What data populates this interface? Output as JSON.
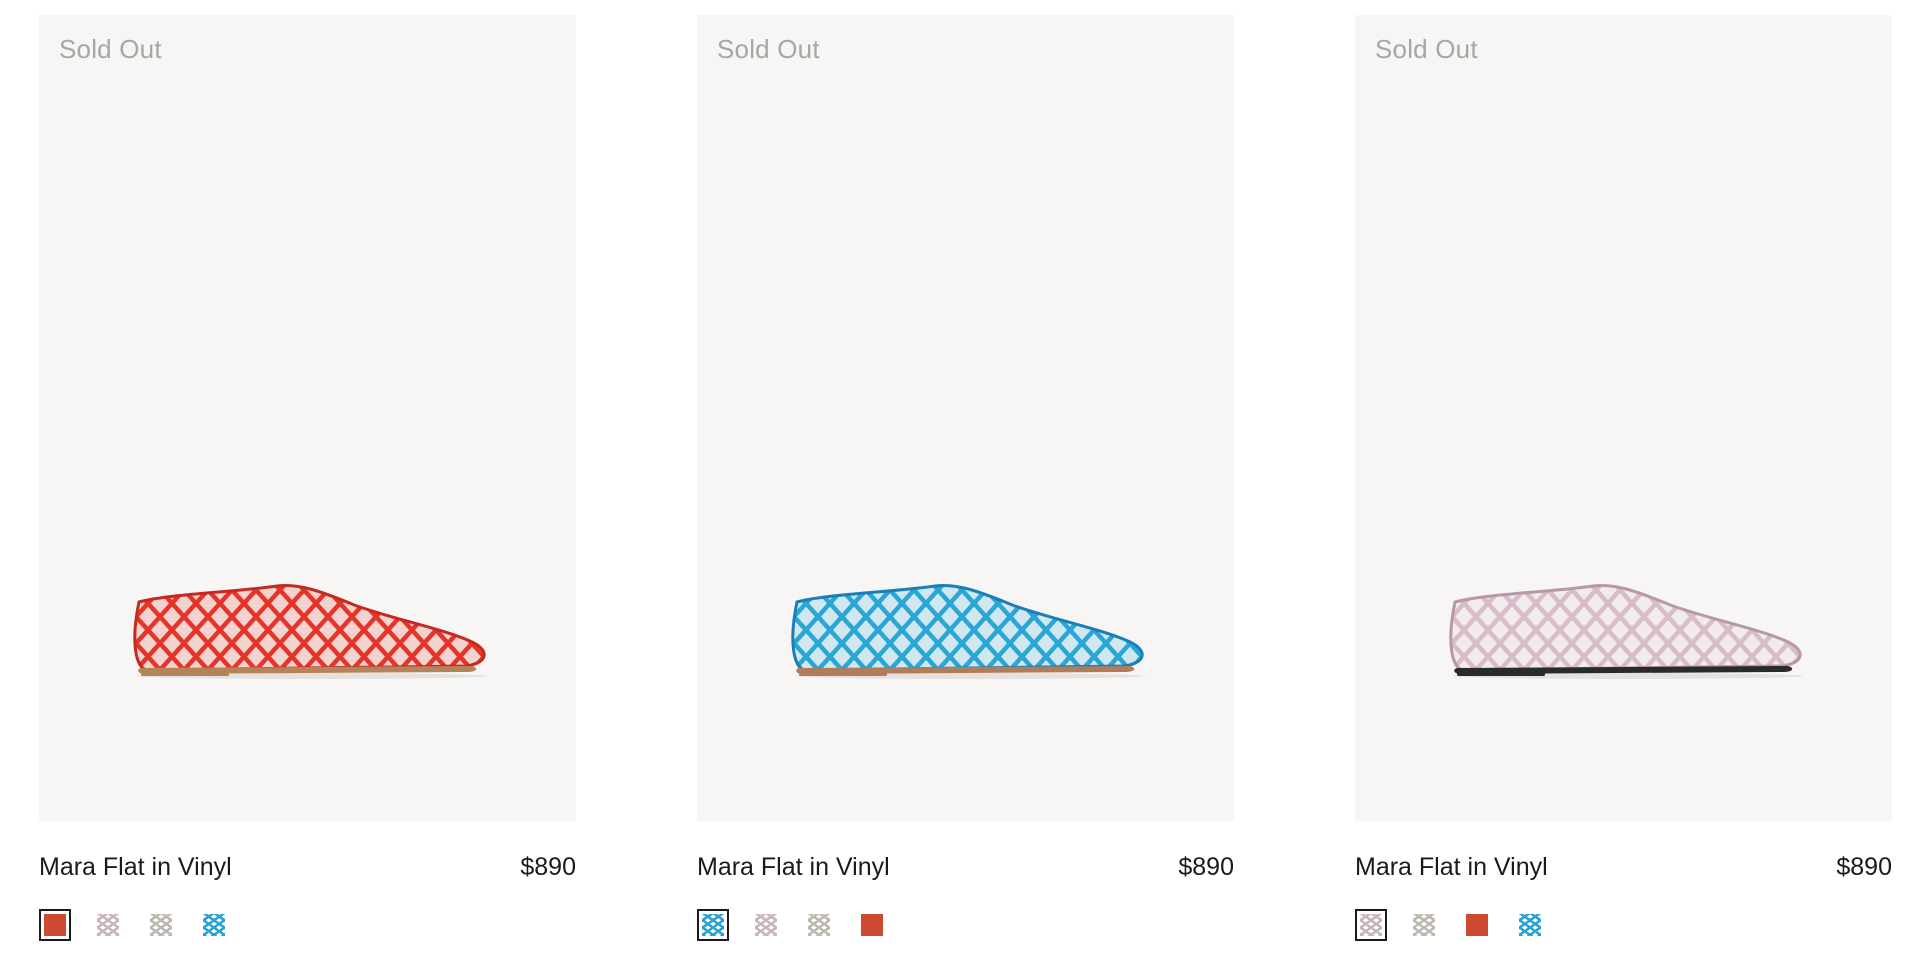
{
  "products": [
    {
      "badge": "Sold Out",
      "name": "Mara Flat in Vinyl",
      "price": "$890",
      "shoe_color": "#e5352a",
      "shoe_shade": "#c42a20",
      "sole_color": "#b58358",
      "swatches": [
        {
          "color": "#cc4a30",
          "label": "red",
          "selected": true
        },
        {
          "color": "#c8b4bf",
          "label": "pink",
          "selected": false
        },
        {
          "color": "#bcb8b0",
          "label": "clear",
          "selected": false
        },
        {
          "color": "#27a3cf",
          "label": "blue",
          "selected": false
        }
      ]
    },
    {
      "badge": "Sold Out",
      "name": "Mara Flat in Vinyl",
      "price": "$890",
      "shoe_color": "#29a5d6",
      "shoe_shade": "#1a7fb8",
      "sole_color": "#b07c5a",
      "swatches": [
        {
          "color": "#27a3cf",
          "label": "blue",
          "selected": true
        },
        {
          "color": "#c8b4bf",
          "label": "pink",
          "selected": false
        },
        {
          "color": "#bcb8b0",
          "label": "clear",
          "selected": false
        },
        {
          "color": "#cc4a30",
          "label": "red",
          "selected": false
        }
      ]
    },
    {
      "badge": "Sold Out",
      "name": "Mara Flat in Vinyl",
      "price": "$890",
      "shoe_color": "#d7bcc9",
      "shoe_shade": "#b898a8",
      "sole_color": "#2a2a2a",
      "swatches": [
        {
          "color": "#c8b4bf",
          "label": "pink",
          "selected": true
        },
        {
          "color": "#bcb8b0",
          "label": "clear",
          "selected": false
        },
        {
          "color": "#cc4a30",
          "label": "red",
          "selected": false
        },
        {
          "color": "#27a3cf",
          "label": "blue",
          "selected": false
        }
      ]
    }
  ]
}
